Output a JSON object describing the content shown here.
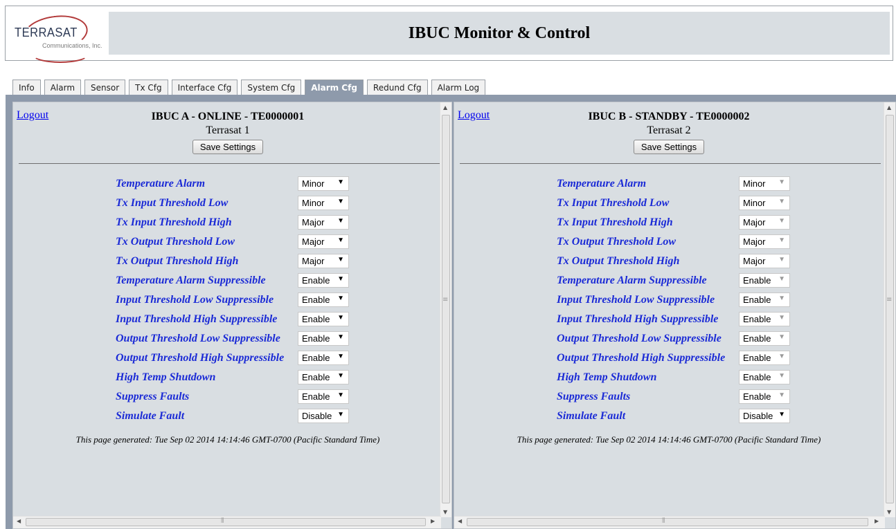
{
  "header": {
    "logo_text": "TERRASAT",
    "logo_sub": "Communications, Inc.",
    "title": "IBUC Monitor & Control"
  },
  "tabs": [
    {
      "label": "Info"
    },
    {
      "label": "Alarm"
    },
    {
      "label": "Sensor"
    },
    {
      "label": "Tx Cfg"
    },
    {
      "label": "Interface Cfg"
    },
    {
      "label": "System Cfg"
    },
    {
      "label": "Alarm Cfg",
      "active": true
    },
    {
      "label": "Redund Cfg"
    },
    {
      "label": "Alarm Log"
    }
  ],
  "frame_a": {
    "logout": "Logout",
    "title": "IBUC A - ONLINE - TE0000001",
    "subtitle": "Terrasat 1",
    "save_label": "Save Settings",
    "rows": [
      {
        "label": "Temperature Alarm",
        "value": "Minor"
      },
      {
        "label": "Tx Input Threshold Low",
        "value": "Minor"
      },
      {
        "label": "Tx Input Threshold High",
        "value": "Major"
      },
      {
        "label": "Tx Output Threshold Low",
        "value": "Major"
      },
      {
        "label": "Tx Output Threshold High",
        "value": "Major"
      },
      {
        "label": "Temperature Alarm Suppressible",
        "value": "Enable"
      },
      {
        "label": "Input Threshold Low Suppressible",
        "value": "Enable"
      },
      {
        "label": "Input Threshold High Suppressible",
        "value": "Enable"
      },
      {
        "label": "Output Threshold Low Suppressible",
        "value": "Enable"
      },
      {
        "label": "Output Threshold High Suppressible",
        "value": "Enable"
      },
      {
        "label": "High Temp Shutdown",
        "value": "Enable"
      },
      {
        "label": "Suppress Faults",
        "value": "Enable"
      },
      {
        "label": "Simulate Fault",
        "value": "Disable"
      }
    ],
    "generated": "This page generated: Tue Sep 02 2014 14:14:46 GMT-0700 (Pacific Standard Time)"
  },
  "frame_b": {
    "logout": "Logout",
    "title": "IBUC B - STANDBY - TE0000002",
    "subtitle": "Terrasat 2",
    "save_label": "Save Settings",
    "rows": [
      {
        "label": "Temperature Alarm",
        "value": "Minor"
      },
      {
        "label": "Tx Input Threshold Low",
        "value": "Minor"
      },
      {
        "label": "Tx Input Threshold High",
        "value": "Major"
      },
      {
        "label": "Tx Output Threshold Low",
        "value": "Major"
      },
      {
        "label": "Tx Output Threshold High",
        "value": "Major"
      },
      {
        "label": "Temperature Alarm Suppressible",
        "value": "Enable"
      },
      {
        "label": "Input Threshold Low Suppressible",
        "value": "Enable"
      },
      {
        "label": "Input Threshold High Suppressible",
        "value": "Enable"
      },
      {
        "label": "Output Threshold Low Suppressible",
        "value": "Enable"
      },
      {
        "label": "Output Threshold High Suppressible",
        "value": "Enable"
      },
      {
        "label": "High Temp Shutdown",
        "value": "Enable"
      },
      {
        "label": "Suppress Faults",
        "value": "Enable"
      },
      {
        "label": "Simulate Fault",
        "value": "Disable"
      }
    ],
    "generated": "This page generated: Tue Sep 02 2014 14:14:46 GMT-0700 (Pacific Standard Time)"
  },
  "colors": {
    "label_blue": "#1a2ad6",
    "panel_bg": "#d9dee2",
    "frame_border": "#8e9aab",
    "active_tab": "#8e9aab",
    "logo_red": "#b23a3a"
  },
  "icons": {
    "dropdown": "chevron-down-icon",
    "scroll_up": "scroll-up-arrow-icon",
    "scroll_down": "scroll-down-arrow-icon",
    "scroll_left": "scroll-left-arrow-icon",
    "scroll_right": "scroll-right-arrow-icon"
  }
}
